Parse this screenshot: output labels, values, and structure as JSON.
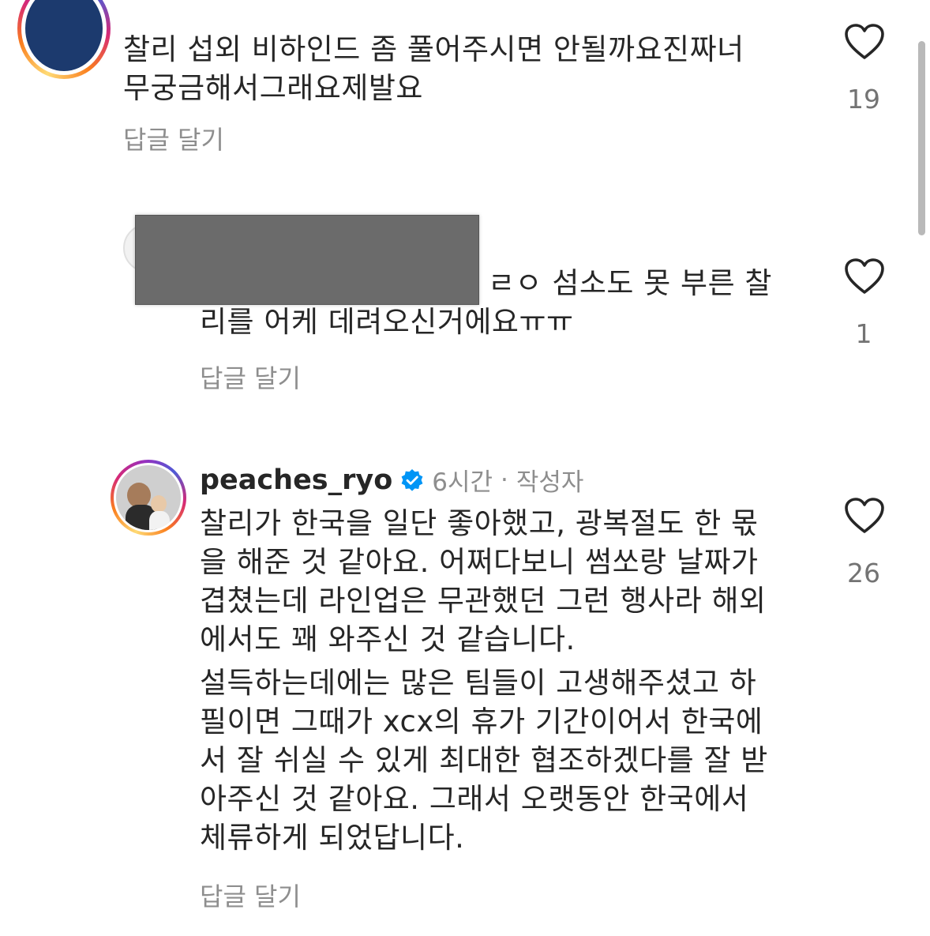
{
  "comments": [
    {
      "text_lines": [
        "찰리 섭외 비하인드 좀 풀어주시면 안될까요진짜너",
        "무궁금해서그래요제발요"
      ],
      "reply_label": "답글 달기",
      "like_count": "19"
    },
    {
      "text_lines": [
        "ㄹㅇ 섬소도 못 부른 찰",
        "리를 어케 데려오신거에요ㅠㅠ"
      ],
      "reply_label": "답글 달기",
      "like_count": "1"
    },
    {
      "username": "peaches_ryo",
      "time": "6시간",
      "separator": "·",
      "author_badge": "작성자",
      "paragraph1": [
        "찰리가 한국을 일단 좋아했고, 광복절도 한 몫",
        "을 해준 것 같아요. 어쩌다보니 썸쏘랑 날짜가",
        "겹쳤는데 라인업은 무관했던 그런 행사라 해외",
        "에서도 꽤 와주신 것 같습니다."
      ],
      "paragraph2": [
        "설득하는데에는 많은 팀들이 고생해주셨고 하",
        "필이면 그때가 xcx의 휴가 기간이어서 한국에",
        "서 잘 쉬실 수 있게 최대한 협조하겠다를 잘 받",
        "아주신 것 같아요. 그래서 오랫동안 한국에서",
        "체류하게 되었답니다."
      ],
      "reply_label": "답글 달기",
      "like_count": "26"
    }
  ],
  "colors": {
    "text": "#262626",
    "secondary": "#8e8e8e",
    "verified": "#0095f6",
    "redaction": "#6b6b6b",
    "avatar_blue": "#1c3a6e"
  }
}
